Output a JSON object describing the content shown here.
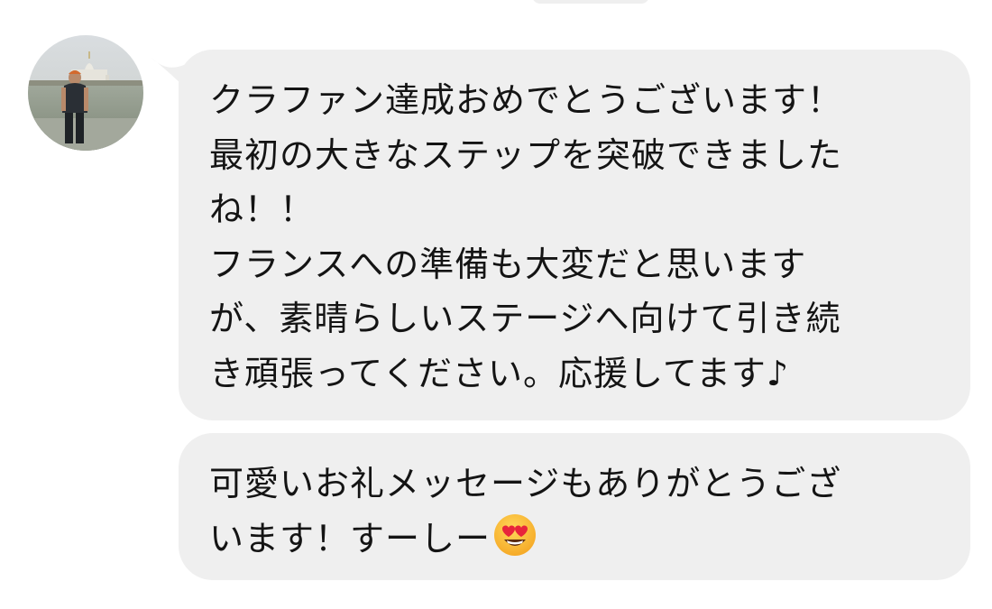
{
  "conversation": {
    "avatar_icon": "user-avatar-photo",
    "bubble_color": "#efefef",
    "messages": [
      {
        "lines": [
          "クラファン達成おめでとうございます！",
          "最初の大きなステップを突破できました",
          "ね！！",
          "フランスへの準備も大変だと思います",
          "が、素晴らしいステージへ向けて引き続",
          "き頑張ってください。応援してます♪"
        ]
      },
      {
        "lines": [
          "可愛いお礼メッセージもありがとうござ",
          "います！すーしー"
        ],
        "trailing_icon": "heart-eyes-emoji-icon"
      }
    ]
  }
}
